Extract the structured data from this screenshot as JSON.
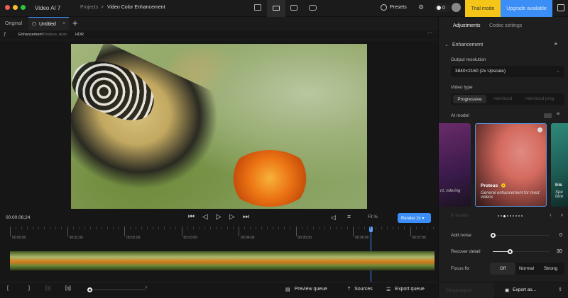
{
  "window": {
    "app_title": "Video AI 7"
  },
  "breadcrumb": {
    "root": "Projects",
    "separator": ">",
    "current": "Video Color Enhancement"
  },
  "header": {
    "presets": "Presets",
    "credits": "0",
    "trial": "Trial mode",
    "upgrade": "Upgrade available",
    "trial_color": "#f5c518",
    "upgrade_color": "#3a8ef6"
  },
  "tabs": {
    "original": "Original",
    "untitled": "Untitled"
  },
  "subheader": {
    "label": "Enhancement",
    "detail": "Proteus, Auto",
    "hdr": "HDR"
  },
  "player": {
    "timecode": "00:00:06;24",
    "fit": "Fit %",
    "render": "Render 2x"
  },
  "timeline": {
    "ticks": [
      "00:00:00",
      "00:01:00",
      "00:02:00",
      "00:03:00",
      "00:04:00",
      "00:05:00",
      "00:06:00",
      "00:07:00"
    ],
    "playhead_fraction": 0.83
  },
  "bottom": {
    "preview_queue": "Preview queue",
    "sources": "Sources",
    "export_queue": "Export queue"
  },
  "panel": {
    "tabs": [
      "Adjustments",
      "Codec settings"
    ],
    "section": "Enhancement",
    "output_resolution_label": "Output resolution",
    "output_resolution": "3840×2160 (2x Upscale)",
    "video_type_label": "Video type",
    "video_types": [
      "Progressive",
      "Interlaced",
      "Interlaced prog."
    ],
    "ai_model_label": "AI model",
    "models": [
      {
        "name": "",
        "desc": "nt, ndering"
      },
      {
        "name": "Proteus",
        "desc": "General enhancement for most videos"
      },
      {
        "name": "Iris",
        "desc": "Spe face"
      }
    ],
    "models_count": "9 models",
    "add_noise_label": "Add noise",
    "add_noise": "0",
    "recover_detail_label": "Recover detail",
    "recover_detail": "30",
    "focus_fix_label": "Focus fix",
    "focus_fix_options": [
      "Off",
      "Normal",
      "Strong"
    ],
    "cloud_export": "Cloud export",
    "export_as": "Export as..."
  }
}
